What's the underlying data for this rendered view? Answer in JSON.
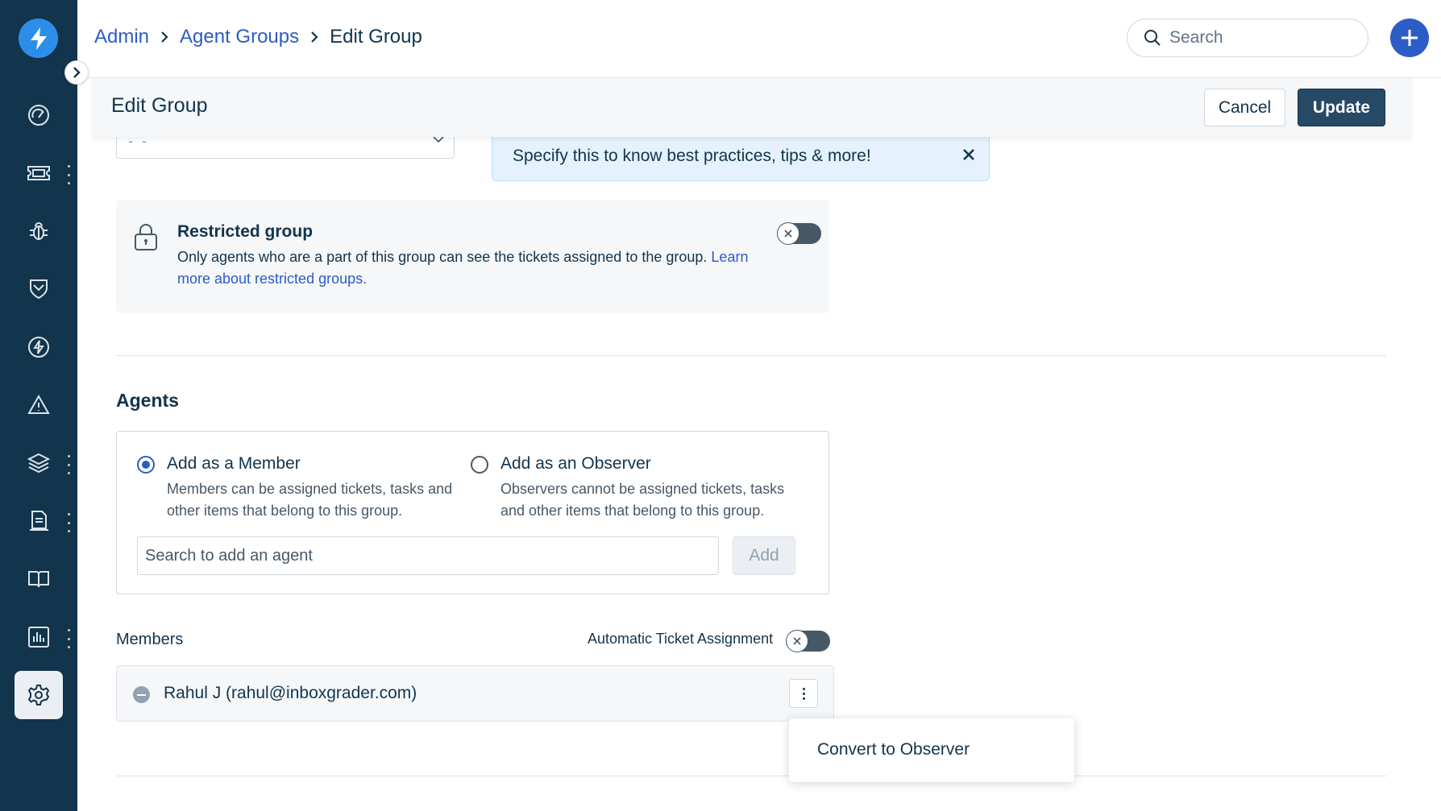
{
  "breadcrumb": {
    "admin": "Admin",
    "agent_groups": "Agent Groups",
    "current": "Edit Group"
  },
  "search": {
    "placeholder": "Search"
  },
  "page": {
    "title": "Edit Group",
    "cancel_label": "Cancel",
    "update_label": "Update"
  },
  "business_hours_select": {
    "value": "- -"
  },
  "tip": {
    "text": "Specify this to know best practices, tips & more!"
  },
  "restricted": {
    "title": "Restricted group",
    "description": "Only agents who are a part of this group can see the tickets assigned to the group.",
    "link_text": "Learn more about restricted groups.",
    "enabled": false
  },
  "agents": {
    "title": "Agents",
    "member_option": {
      "title": "Add as a Member",
      "description": "Members can be assigned tickets, tasks and other items that belong to this group.",
      "checked": true
    },
    "observer_option": {
      "title": "Add as an Observer",
      "description": "Observers cannot be assigned tickets, tasks and other items that belong to this group.",
      "checked": false
    },
    "search_placeholder": "Search to add an agent",
    "add_label": "Add"
  },
  "members": {
    "label": "Members",
    "auto_assignment_label": "Automatic Ticket Assignment",
    "auto_assignment_enabled": false,
    "list": [
      {
        "name": "Rahul J (rahul@inboxgrader.com)"
      }
    ]
  },
  "context_menu": {
    "items": [
      "Convert to Observer"
    ]
  },
  "colors": {
    "sidebar": "#12344d",
    "brand": "#2c5cc5",
    "logo": "#2c8ee8",
    "primary_button": "#264966"
  },
  "sidebar_icons": [
    "dashboard-icon",
    "tickets-icon",
    "problems-icon",
    "changes-icon",
    "releases-icon",
    "alerts-icon",
    "assets-icon",
    "contracts-icon",
    "solutions-icon",
    "reports-icon",
    "admin-gear-icon"
  ]
}
